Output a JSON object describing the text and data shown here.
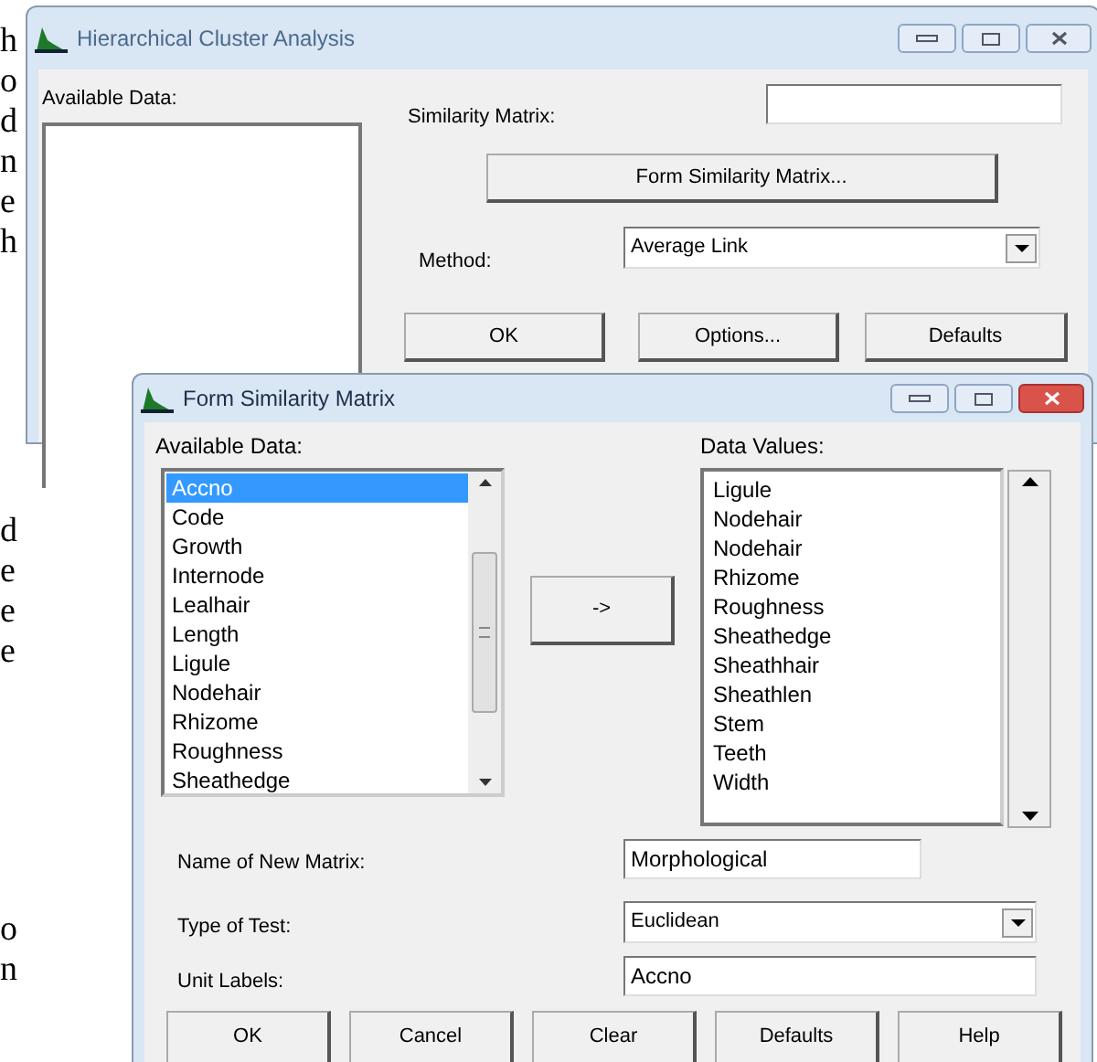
{
  "background_text": [
    [
      "h",
      "o",
      "d",
      "n",
      "e",
      "h"
    ],
    [
      "d",
      "e",
      "e",
      "e"
    ],
    [
      "o",
      "n"
    ]
  ],
  "main_window": {
    "title": "Hierarchical Cluster Analysis",
    "available_data_label": "Available Data:",
    "similarity_matrix_label": "Similarity Matrix:",
    "form_button": "Form Similarity Matrix...",
    "method_label": "Method:",
    "method_value": "Average Link",
    "buttons": [
      "OK",
      "Options...",
      "Defaults"
    ]
  },
  "dialog": {
    "title": "Form Similarity Matrix",
    "available_data_label": "Available Data:",
    "available_items": [
      {
        "label": "Accno",
        "selected": true
      },
      {
        "label": "Code",
        "selected": false
      },
      {
        "label": "Growth",
        "selected": false
      },
      {
        "label": "Internode",
        "selected": false
      },
      {
        "label": "Lealhair",
        "selected": false
      },
      {
        "label": "Length",
        "selected": false
      },
      {
        "label": "Ligule",
        "selected": false
      },
      {
        "label": "Nodehair",
        "selected": false
      },
      {
        "label": "Rhizome",
        "selected": false
      },
      {
        "label": "Roughness",
        "selected": false
      },
      {
        "label": "Sheathedge",
        "selected": false
      }
    ],
    "move_button": "->",
    "data_values_label": "Data Values:",
    "data_values": [
      "Ligule",
      "Nodehair",
      "Nodehair",
      "Rhizome",
      "Roughness",
      "Sheathedge",
      "Sheathhair",
      "Sheathlen",
      "Stem",
      "Teeth",
      "Width"
    ],
    "name_label": "Name of New Matrix:",
    "name_value": "Morphological",
    "test_label": "Type of Test:",
    "test_value": "Euclidean",
    "unit_label": "Unit Labels:",
    "unit_value": "Accno",
    "buttons": [
      "OK",
      "Cancel",
      "Clear",
      "Defaults",
      "Help"
    ]
  }
}
